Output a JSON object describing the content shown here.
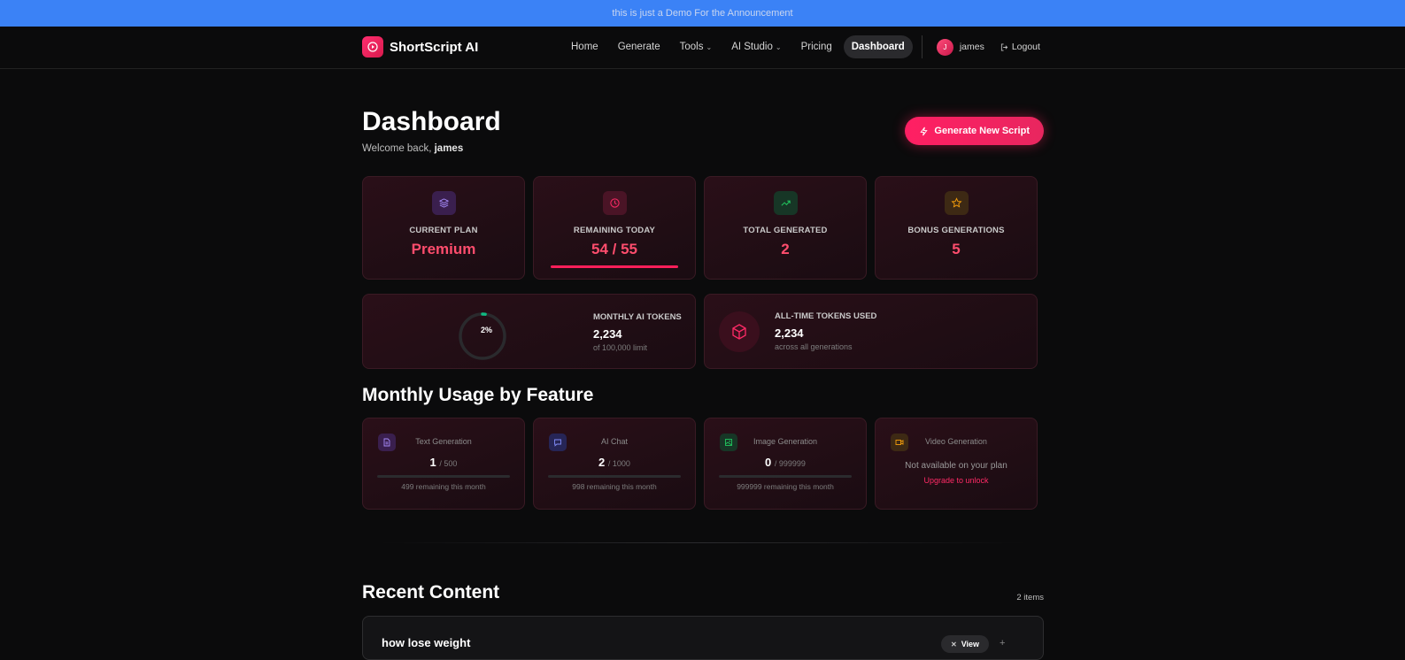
{
  "announcement": "this is just a Demo For the Announcement",
  "brand": {
    "name": "ShortScript AI"
  },
  "nav": {
    "home": "Home",
    "generate": "Generate",
    "tools": "Tools",
    "ai_studio": "AI Studio",
    "pricing": "Pricing",
    "dashboard": "Dashboard",
    "user_initial": "J",
    "user_name": "james",
    "logout": "Logout"
  },
  "page": {
    "title": "Dashboard",
    "welcome_prefix": "Welcome back,",
    "welcome_name": "james",
    "generate_button": "Generate New Script"
  },
  "stats": [
    {
      "label": "CURRENT PLAN",
      "value": "Premium",
      "icon": "layers-icon",
      "color": "#8b5cf6"
    },
    {
      "label": "REMAINING TODAY",
      "value": "54 / 55",
      "icon": "clock-icon",
      "color": "#ff2a66",
      "progress": 0.98
    },
    {
      "label": "TOTAL GENERATED",
      "value": "2",
      "icon": "trending-up-icon",
      "color": "#22c55e"
    },
    {
      "label": "BONUS GENERATIONS",
      "value": "5",
      "icon": "star-icon",
      "color": "#f59e0b"
    }
  ],
  "tokens": {
    "monthly_label": "MONTHLY AI TOKENS",
    "monthly_value": "2,234",
    "monthly_sub": "of 100,000 limit",
    "monthly_percent_text": "2%",
    "monthly_percent": 2,
    "alltime_label": "ALL-TIME TOKENS USED",
    "alltime_value": "2,234",
    "alltime_sub": "across all generations"
  },
  "usage": {
    "heading": "Monthly Usage by Feature",
    "features": [
      {
        "name": "Text Generation",
        "used": "1",
        "limit": "/ 500",
        "remaining": "499 remaining this month",
        "icon": "document-icon",
        "color": "#8b5cf6"
      },
      {
        "name": "AI Chat",
        "used": "2",
        "limit": "/ 1000",
        "remaining": "998 remaining this month",
        "icon": "chat-icon",
        "color": "#6366f1"
      },
      {
        "name": "Image Generation",
        "used": "0",
        "limit": "/ 999999",
        "remaining": "999999 remaining this month",
        "icon": "image-icon",
        "color": "#22c55e"
      },
      {
        "name": "Video Generation",
        "unavailable": "Not available on your plan",
        "upgrade": "Upgrade to unlock",
        "icon": "video-icon",
        "color": "#f59e0b"
      }
    ]
  },
  "recent": {
    "heading": "Recent Content",
    "count": "2 items",
    "items": [
      {
        "title": "how lose weight",
        "view": "View"
      }
    ]
  }
}
